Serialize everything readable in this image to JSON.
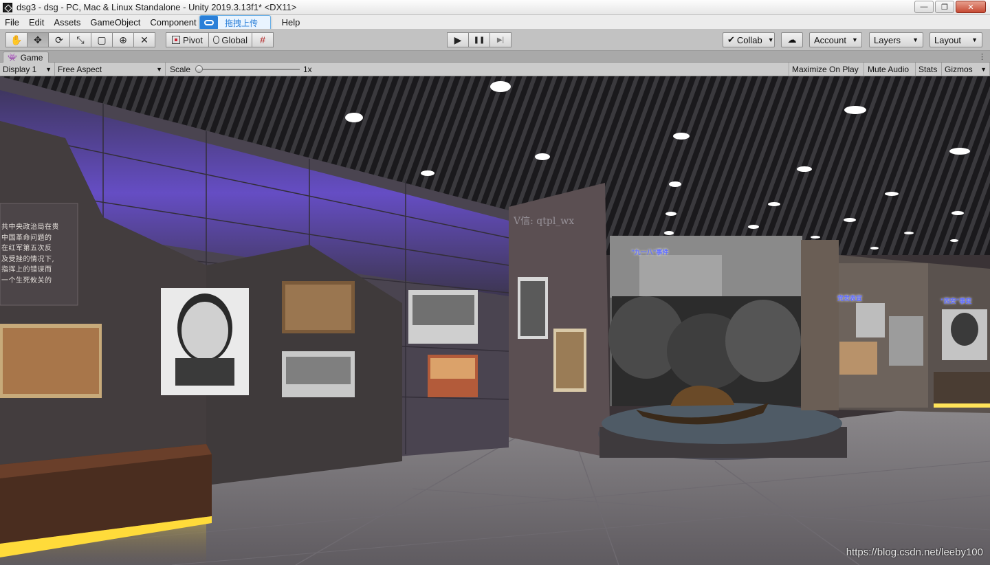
{
  "window": {
    "title": "dsg3 - dsg - PC, Mac & Linux Standalone - Unity 2019.3.13f1* <DX11>",
    "controls": {
      "minimize": "—",
      "restore": "❐",
      "close": "✕"
    }
  },
  "menu": {
    "items": [
      "File",
      "Edit",
      "Assets",
      "GameObject",
      "Component",
      "",
      "Help"
    ],
    "upload_popup": "拖拽上传"
  },
  "toolbar": {
    "tools": [
      {
        "name": "hand-tool",
        "glyph": "✋"
      },
      {
        "name": "move-tool",
        "glyph": "✥"
      },
      {
        "name": "rotate-tool",
        "glyph": "⟳"
      },
      {
        "name": "scale-tool",
        "glyph": "⤡"
      },
      {
        "name": "rect-tool",
        "glyph": "▢"
      },
      {
        "name": "transform-tool",
        "glyph": "⊕"
      },
      {
        "name": "custom-tool",
        "glyph": "✕"
      }
    ],
    "pivot_label": "Pivot",
    "global_label": "Global",
    "grid_icon": "#",
    "play_glyph": "▶",
    "pause_glyph": "❚❚",
    "step_glyph": "▶|",
    "collab_label": "Collab",
    "cloud_glyph": "☁",
    "account_label": "Account",
    "layers_label": "Layers",
    "layout_label": "Layout",
    "dropdown_arrow": "▼"
  },
  "game_tab": {
    "label": "Game",
    "icon": "👾"
  },
  "game_toolbar": {
    "display": "Display 1",
    "aspect": "Free Aspect",
    "scale_label": "Scale",
    "scale_value": "1x",
    "scale_level": 0.0,
    "maximize": "Maximize On Play",
    "mute": "Mute Audio",
    "stats": "Stats",
    "gizmos": "Gizmos"
  },
  "scene": {
    "wall_text": [
      "共中央政治局在贵",
      "中国革命问题的",
      "在红军第五次反",
      "及受挫的情况下,",
      "指挥上的错误而",
      "一个生死攸关的"
    ],
    "watermark": "V信: qtpl_wx",
    "panel_title_1": "\"九一八\"事件",
    "panel_title_2": "党发表宣",
    "panel_title_3": "\"西安\"事变",
    "url": "https://blog.csdn.net/leeby100"
  }
}
